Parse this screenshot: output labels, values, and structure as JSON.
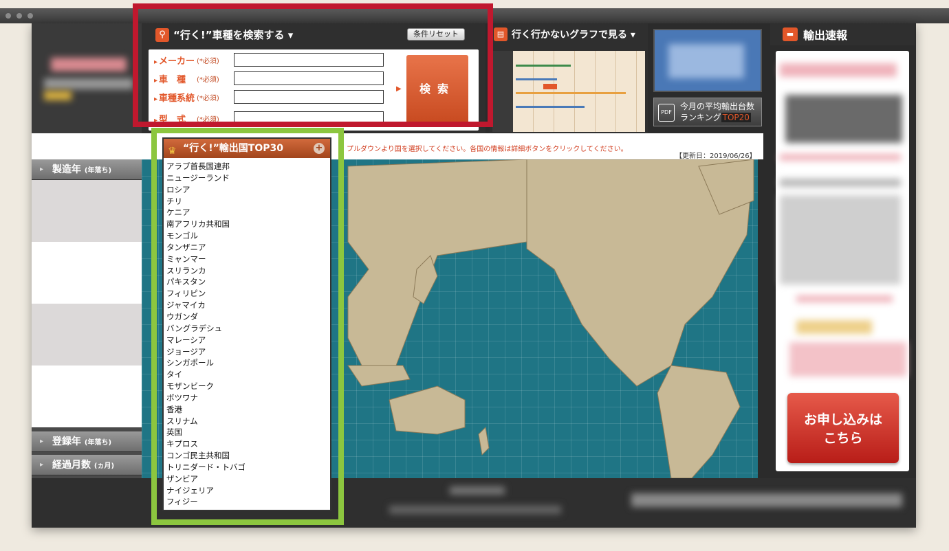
{
  "search_panel": {
    "title": "“行く!”車種を検索する ▾",
    "reset_label": "条件リセット",
    "fields": [
      {
        "label": "メーカー",
        "req": "(*必須)"
      },
      {
        "label": "車　種",
        "req": "(*必須)"
      },
      {
        "label": "車種系統",
        "req": "(*必須)"
      },
      {
        "label": "型　式",
        "req": "(*必須)"
      }
    ],
    "search_label": "検索"
  },
  "graph_panel": {
    "title": "行く行かないグラフで見る ▾"
  },
  "pdf_button": {
    "line1": "今月の平均輸出台数",
    "line2": "ランキング",
    "highlight": "TOP20",
    "icon": "PDF"
  },
  "news": {
    "title": "輸出速報",
    "apply_line1": "お申し込みは",
    "apply_line2": "こちら"
  },
  "notice": "プルダウンより国を選択してください。各国の情報は詳細ボタンをクリックしてください。",
  "updated": "【更新日：2019/06/26】",
  "filters": {
    "year": {
      "label": "製造年",
      "sub": "(年落ち)"
    },
    "registered": {
      "label": "登録年",
      "sub": "(年落ち)"
    },
    "months": {
      "label": "経過月数",
      "sub": "(ヵ月)"
    }
  },
  "top30": {
    "title": "“行く!”輸出国TOP30",
    "countries": [
      "アラブ首長国連邦",
      "ニュージーランド",
      "ロシア",
      "チリ",
      "ケニア",
      "南アフリカ共和国",
      "モンゴル",
      "タンザニア",
      "ミャンマー",
      "スリランカ",
      "パキスタン",
      "フィリピン",
      "ジャマイカ",
      "ウガンダ",
      "バングラデシュ",
      "マレーシア",
      "ジョージア",
      "シンガポール",
      "タイ",
      "モザンビーク",
      "ボツワナ",
      "香港",
      "スリナム",
      "英国",
      "キプロス",
      "コンゴ民主共和国",
      "トリニダード・トバゴ",
      "ザンビア",
      "ナイジェリア",
      "フィジー"
    ]
  },
  "colors": {
    "accent": "#e2572a",
    "highlight_red": "#c0182e",
    "highlight_green": "#8cc63f",
    "ocean": "#1f7585",
    "land": "#c8b996"
  }
}
